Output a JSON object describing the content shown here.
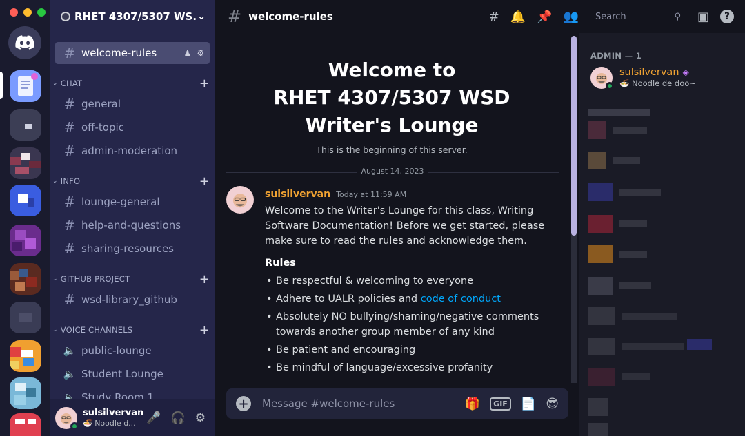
{
  "window": {
    "dots": [
      "#ff5f57",
      "#febc2e",
      "#28c840"
    ]
  },
  "guild": {
    "name": "RHET 4307/5307 WS..."
  },
  "channels": {
    "active": {
      "name": "welcome-rules"
    },
    "categories": [
      {
        "label": "CHAT",
        "items": [
          "general",
          "off-topic",
          "admin-moderation"
        ]
      },
      {
        "label": "INFO",
        "items": [
          "lounge-general",
          "help-and-questions",
          "sharing-resources"
        ]
      },
      {
        "label": "GITHUB PROJECT",
        "items": [
          "wsd-library_github"
        ]
      },
      {
        "label": "VOICE CHANNELS",
        "items": [
          "public-lounge",
          "Student Lounge",
          "Study Room 1"
        ]
      }
    ]
  },
  "user": {
    "name": "sulsilvervan",
    "status": "Noodle d..."
  },
  "topbar": {
    "channel": "welcome-rules",
    "search_placeholder": "Search"
  },
  "welcome": {
    "line1": "Welcome to",
    "line2": "RHET 4307/5307 WSD",
    "line3": "Writer's Lounge",
    "sub": "This is the beginning of this server."
  },
  "date_divider": "August 14, 2023",
  "message": {
    "author": "sulsilvervan",
    "timestamp": "Today at 11:59 AM",
    "text": "Welcome to the Writer's Lounge for this class, Writing Software Documentation! Before we get started, please make sure to read the rules and acknowledge them.",
    "rules_heading": "Rules",
    "rules": [
      "Be respectful & welcoming to everyone",
      "Adhere to UALR policies and ",
      "Absolutely NO bullying/shaming/negative comments towards another group member of any kind",
      "Be patient and encouraging",
      "Be mindful of language/excessive profanity"
    ],
    "link_text": "code of conduct"
  },
  "composer": {
    "placeholder": "Message #welcome-rules",
    "gif_label": "GIF"
  },
  "members": {
    "header": "ADMIN — 1",
    "admin": {
      "name": "sulsilvervan",
      "status": "Noodle de doo~"
    }
  },
  "colors": {
    "accent": "#5865f2",
    "author": "#f0a232",
    "link": "#00a8fc",
    "online": "#23a55a"
  }
}
